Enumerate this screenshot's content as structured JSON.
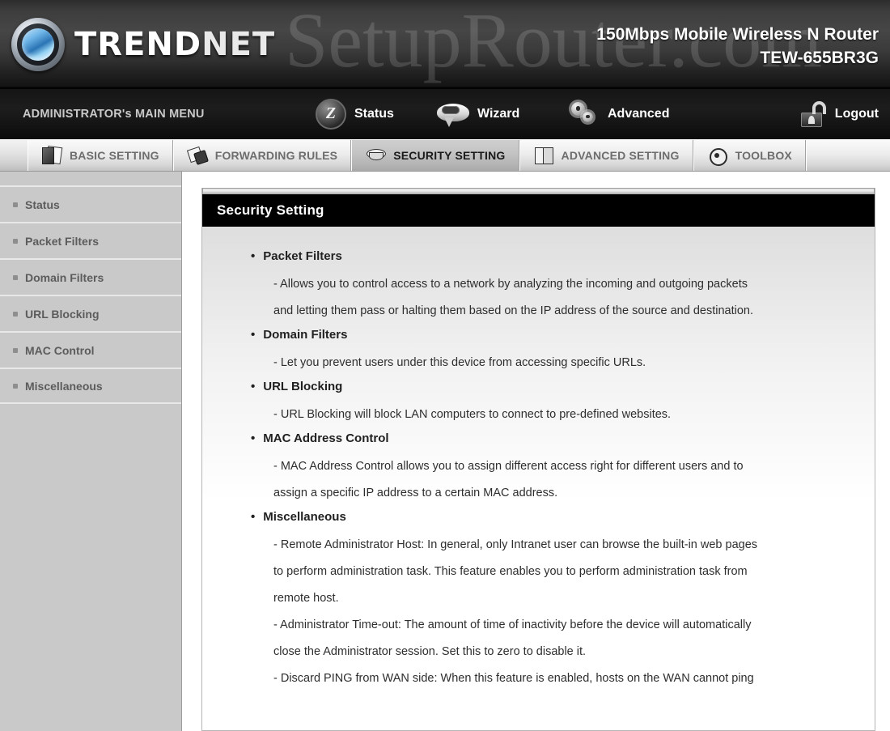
{
  "brand": {
    "logo_text": "TREND",
    "logo_text_accent": "NET",
    "logo_icon": "trendnet-globe-icon",
    "watermark": "SetupRouter.com",
    "product_name": "150Mbps Mobile Wireless N Router",
    "model": "TEW-655BR3G"
  },
  "mainmenu": {
    "admin_label": "ADMINISTRATOR's MAIN MENU",
    "items": [
      {
        "label": "Status",
        "icon": "status-icon"
      },
      {
        "label": "Wizard",
        "icon": "wizard-icon"
      },
      {
        "label": "Advanced",
        "icon": "advanced-gears-icon"
      },
      {
        "label": "Logout",
        "icon": "unlocked-padlock-icon"
      }
    ]
  },
  "tabs": [
    {
      "label": "BASIC SETTING",
      "icon": "folder-pages-icon",
      "active": false
    },
    {
      "label": "FORWARDING RULES",
      "icon": "forward-arrows-icon",
      "active": false
    },
    {
      "label": "SECURITY SETTING",
      "icon": "hex-nut-icon",
      "active": true
    },
    {
      "label": "ADVANCED SETTING",
      "icon": "open-book-icon",
      "active": false
    },
    {
      "label": "TOOLBOX",
      "icon": "gear-wrench-icon",
      "active": false
    }
  ],
  "sidebar": {
    "items": [
      {
        "label": "Status"
      },
      {
        "label": "Packet Filters"
      },
      {
        "label": "Domain Filters"
      },
      {
        "label": "URL Blocking"
      },
      {
        "label": "MAC Control"
      },
      {
        "label": "Miscellaneous"
      }
    ]
  },
  "panel": {
    "title": "Security Setting",
    "bullet": "•",
    "sections": [
      {
        "heading": "Packet Filters",
        "lines": [
          "- Allows you to control access to a network by analyzing the incoming and outgoing packets",
          "and letting them pass or halting them based on the IP address of the source and destination."
        ]
      },
      {
        "heading": "Domain Filters",
        "lines": [
          "- Let you prevent users under this device from accessing specific URLs."
        ]
      },
      {
        "heading": "URL Blocking",
        "lines": [
          "- URL Blocking will block LAN computers to connect to pre-defined websites."
        ]
      },
      {
        "heading": "MAC Address Control",
        "lines": [
          "- MAC Address Control allows you to assign different access right for different users and to",
          "assign a specific IP address to a certain MAC address."
        ]
      },
      {
        "heading": "Miscellaneous",
        "lines": [
          "- Remote Administrator Host: In general, only Intranet user can browse the built-in web pages",
          "to perform administration task. This feature enables you to perform administration task from",
          "remote host.",
          "- Administrator Time-out: The amount of time of inactivity before the device will automatically",
          "close the Administrator session. Set this to zero to disable it.",
          "- Discard PING from WAN side: When this feature is enabled, hosts on the WAN cannot ping"
        ]
      }
    ]
  },
  "colors": {
    "header_dark": "#3a3a3a",
    "menu_black": "#151515",
    "tab_active": "#b4b4b4",
    "sidebar_bg": "#c9c9c9",
    "panel_title_bg": "#000000",
    "text_dark": "#212121"
  }
}
